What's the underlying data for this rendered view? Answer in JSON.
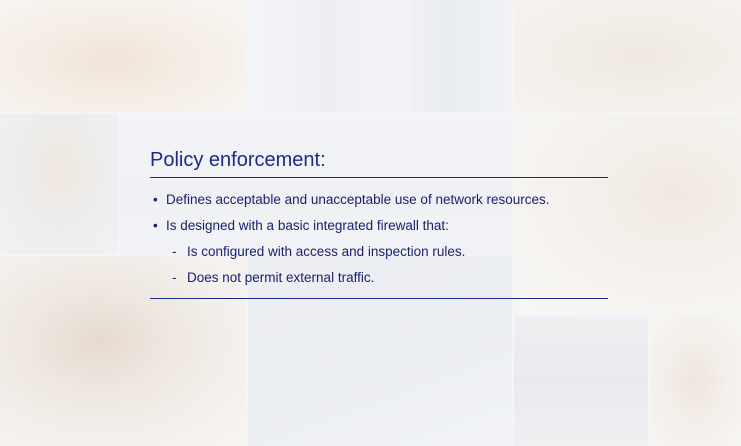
{
  "slide": {
    "title": "Policy enforcement:",
    "accent_color": "#1a2a8c",
    "text_color": "#1a2070",
    "bullets": [
      {
        "marker": "•",
        "text": "Defines acceptable and unacceptable use of network resources."
      },
      {
        "marker": "•",
        "text": "Is designed with a basic integrated firewall that:"
      }
    ],
    "sub_bullets": [
      {
        "marker": "-",
        "text": "Is configured with access and inspection rules."
      },
      {
        "marker": "-",
        "text": "Does not permit external traffic."
      }
    ]
  }
}
